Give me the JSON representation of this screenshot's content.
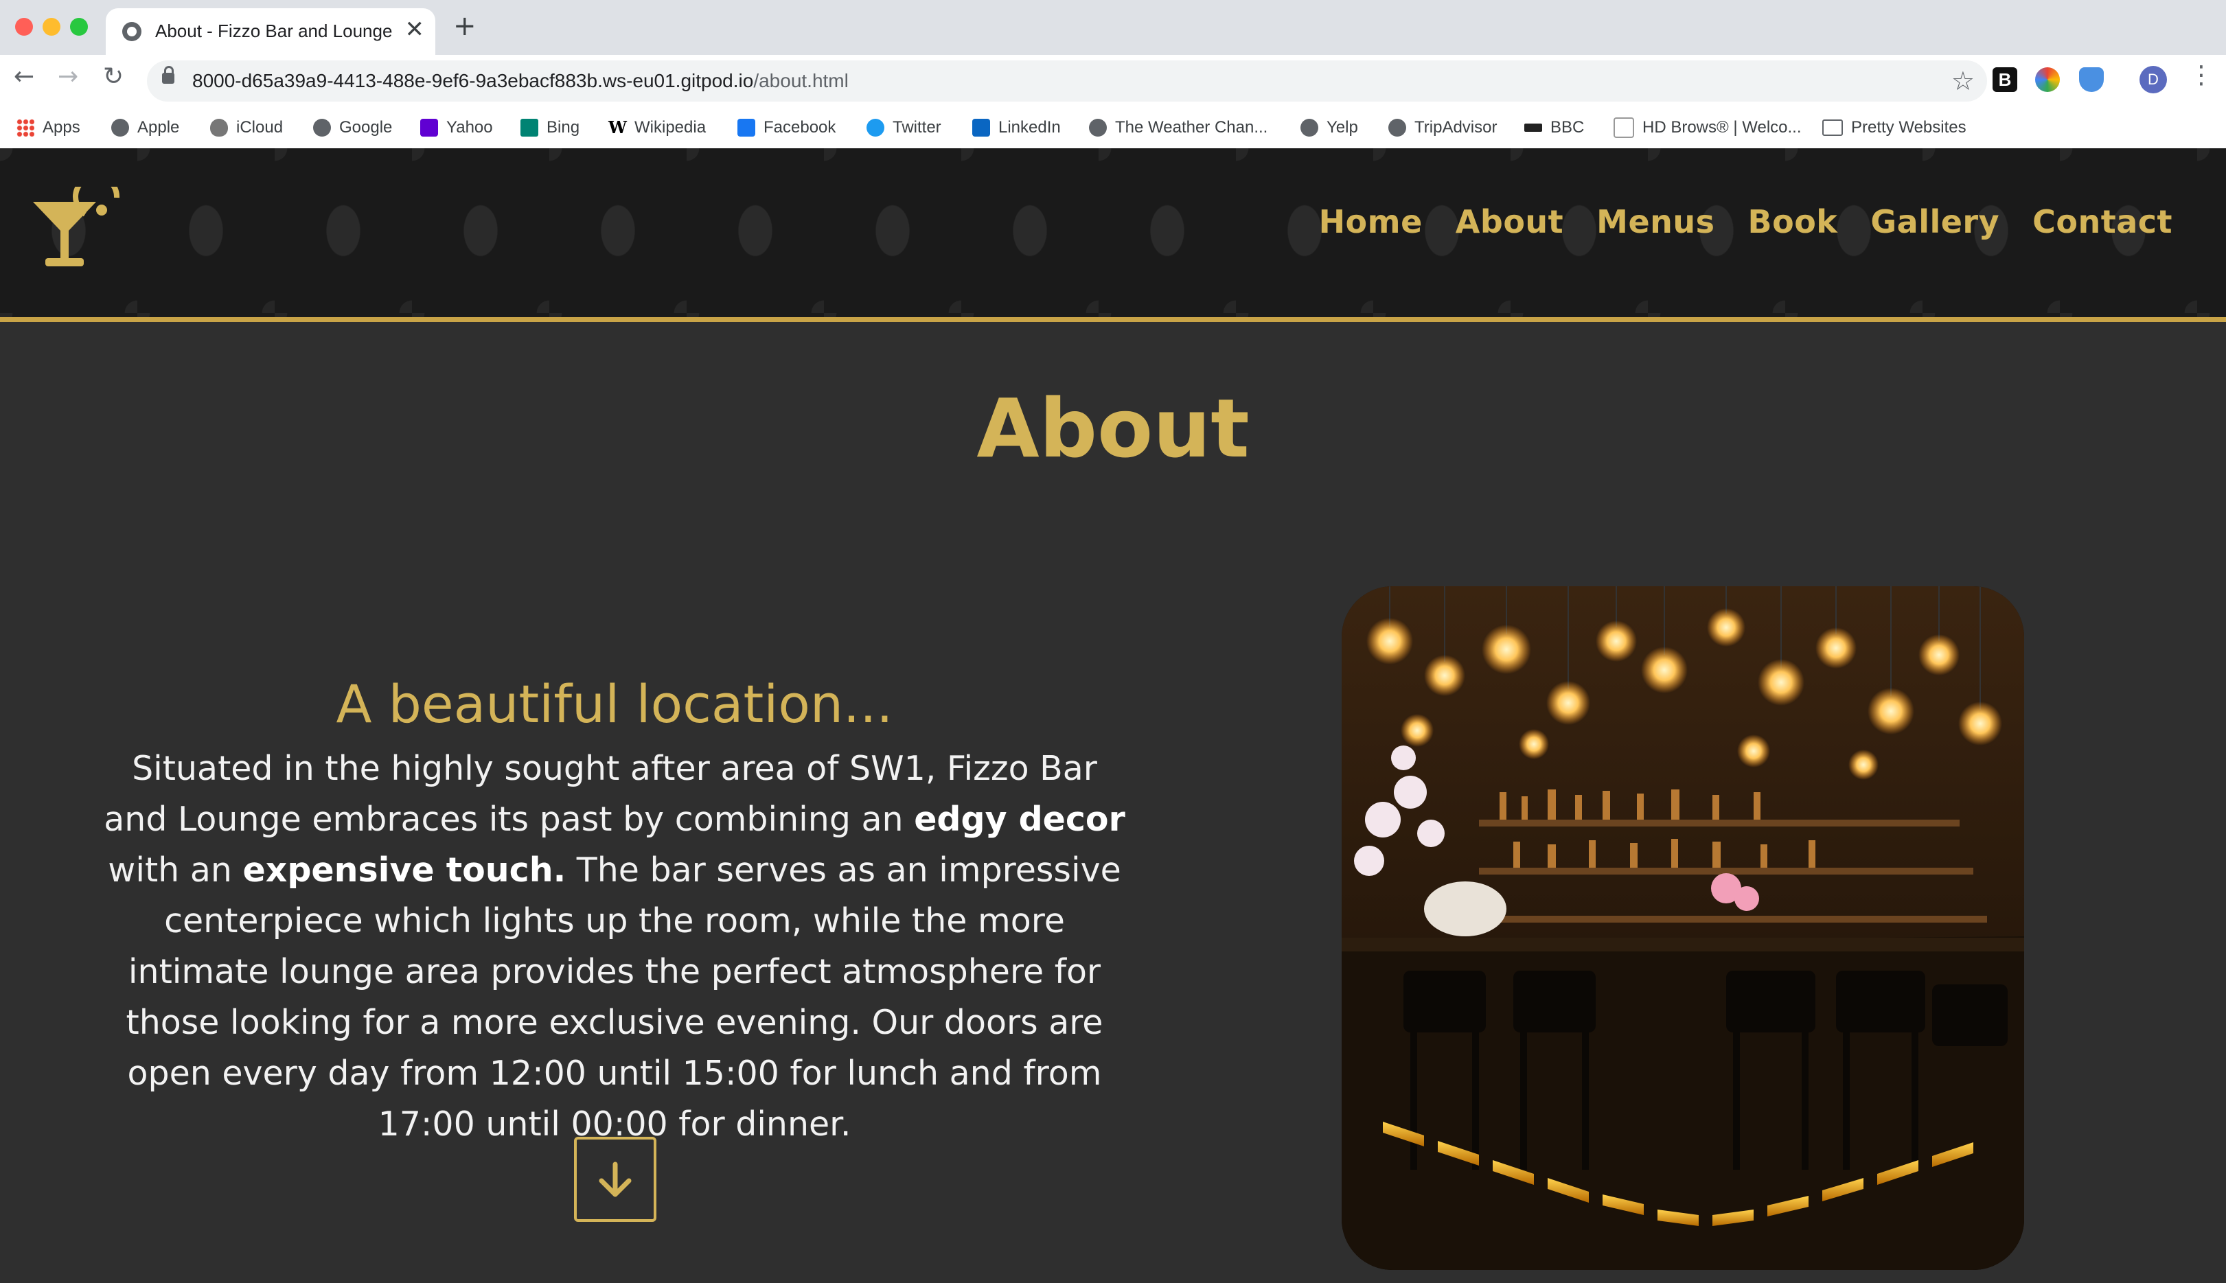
{
  "browser": {
    "tab_title": "About - Fizzo Bar and Lounge",
    "tab_close": "✕",
    "new_tab": "+",
    "url_host": "8000-d65a39a9-4413-488e-9ef6-9a3ebacf883b.ws-eu01.gitpod.io",
    "url_path": "/about.html",
    "avatar_initial": "D",
    "extension_b": "B",
    "bookmarks": [
      {
        "label": "Apps",
        "icon": "apps-grid-icon"
      },
      {
        "label": "Apple",
        "icon": "globe-icon"
      },
      {
        "label": "iCloud",
        "icon": "apple-icon"
      },
      {
        "label": "Google",
        "icon": "globe-icon"
      },
      {
        "label": "Yahoo",
        "icon": "yahoo-icon"
      },
      {
        "label": "Bing",
        "icon": "bing-icon"
      },
      {
        "label": "Wikipedia",
        "icon": "wikipedia-icon"
      },
      {
        "label": "Facebook",
        "icon": "facebook-icon"
      },
      {
        "label": "Twitter",
        "icon": "twitter-icon"
      },
      {
        "label": "LinkedIn",
        "icon": "linkedin-icon"
      },
      {
        "label": "The Weather Chan...",
        "icon": "globe-icon"
      },
      {
        "label": "Yelp",
        "icon": "globe-icon"
      },
      {
        "label": "TripAdvisor",
        "icon": "globe-icon"
      },
      {
        "label": "BBC",
        "icon": "bbc-icon"
      },
      {
        "label": "HD Brows® | Welco...",
        "icon": "page-icon"
      },
      {
        "label": "Pretty Websites",
        "icon": "folder-icon"
      }
    ]
  },
  "site": {
    "nav": [
      "Home",
      "About",
      "Menus",
      "Book",
      "Gallery",
      "Contact"
    ],
    "page_heading": "About",
    "section_title": "A beautiful location...",
    "paragraph": {
      "part1": "Situated in the highly sought after area of SW1, Fizzo Bar and Lounge embraces its past by combining an ",
      "bold1": "edgy decor",
      "part2": " with an ",
      "bold2": "expensive touch.",
      "part3": " The bar serves as an impressive centerpiece which lights up the room, while the more intimate lounge area provides the perfect atmosphere for those looking for a more exclusive evening. Our doors are open every day from 12:00 until 15:00 for lunch and from 17:00 until 00:00 for dinner."
    },
    "scroll_icon": "arrow-down-icon",
    "image_subject": "bar-interior-photo"
  },
  "colors": {
    "gold": "#d4b458",
    "background": "#2f2f2f",
    "header_border": "#c9a447"
  }
}
